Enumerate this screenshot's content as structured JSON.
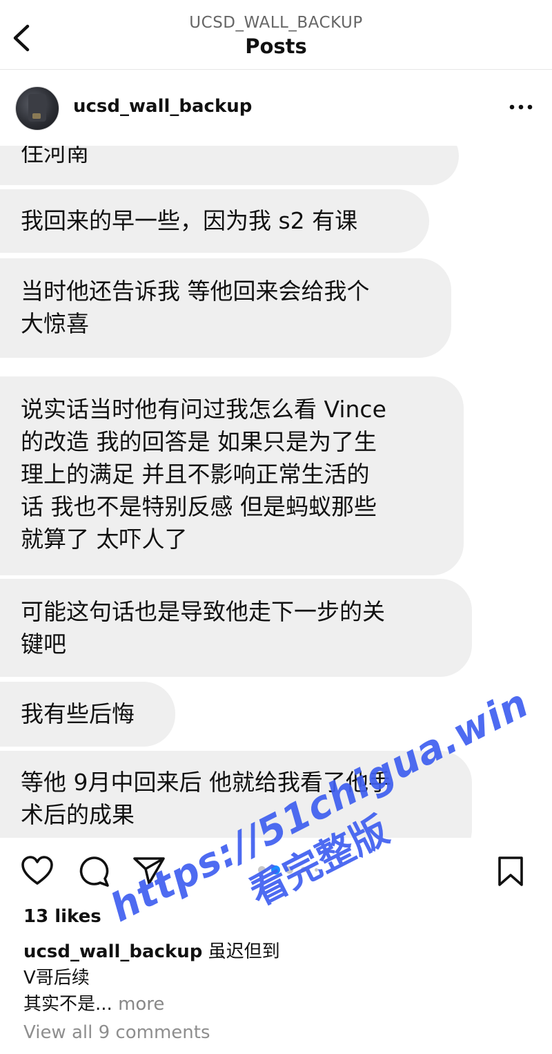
{
  "header": {
    "account_handle": "UCSD_WALL_BACKUP",
    "title": "Posts"
  },
  "post": {
    "username": "ucsd_wall_backup",
    "messages": [
      "住河南",
      "我回来的早一些，因为我 s2 有课",
      "当时他还告诉我 等他回来会给我个\n大惊喜",
      "说实话当时他有问过我怎么看 Vince\n的改造 我的回答是 如果只是为了生\n理上的满足 并且不影响正常生活的\n话 我也不是特别反感 但是蚂蚁那些\n就算了 太吓人了",
      "可能这句话也是导致他走下一步的关\n键吧",
      "我有些后悔",
      "等他 9月中回来后 他就给我看了他手\n术后的成果"
    ],
    "carousel": {
      "total": 5,
      "active_index": 1
    },
    "likes": "13 likes",
    "caption": {
      "username": "ucsd_wall_backup",
      "text1": "虽迟但到",
      "text2": "V哥后续",
      "text3": "其实不是...",
      "more": "more"
    },
    "view_comments": "View all 9 comments"
  },
  "icons": {
    "back": "chevron-left-icon",
    "options": "more-horizontal-icon",
    "like": "heart-icon",
    "comment": "comment-icon",
    "share": "send-icon",
    "save": "bookmark-icon"
  },
  "watermark": {
    "line1": "https://51chigua.win",
    "line2": "看完整版",
    "color": "#3f5ff0"
  },
  "colors": {
    "bubble": "#efefef",
    "carousel_active": "#1a8cff",
    "muted_text": "#8e8e8e"
  }
}
